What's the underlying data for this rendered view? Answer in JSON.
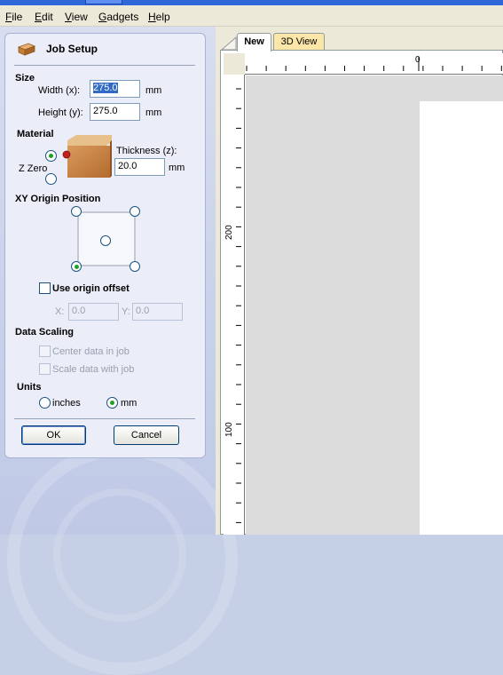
{
  "menu": [
    {
      "label": "File"
    },
    {
      "label": "Edit"
    },
    {
      "label": "View"
    },
    {
      "label": "Gadgets"
    },
    {
      "label": "Help"
    }
  ],
  "job_setup": {
    "title": "Job Setup",
    "size": {
      "heading": "Size",
      "width_label": "Width (x):",
      "width_value": "275.0",
      "width_unit": "mm",
      "height_label": "Height (y):",
      "height_value": "275.0",
      "height_unit": "mm"
    },
    "material": {
      "heading": "Material",
      "thickness_label": "Thickness (z):",
      "thickness_value": "20.0",
      "thickness_unit": "mm",
      "zzero_label": "Z Zero"
    },
    "xy_origin": {
      "heading": "XY Origin Position",
      "selected": "bottom-left"
    },
    "origin_offset": {
      "label": "Use origin offset",
      "checked": false,
      "x_label": "X:",
      "x_value": "0.0",
      "y_label": "Y:",
      "y_value": "0.0"
    },
    "data_scaling": {
      "heading": "Data Scaling",
      "center_label": "Center data in job",
      "scale_label": "Scale data with job"
    },
    "units": {
      "heading": "Units",
      "inches_label": "inches",
      "mm_label": "mm",
      "selected": "mm"
    },
    "ok_label": "OK",
    "cancel_label": "Cancel"
  },
  "tabs": [
    {
      "label": "New",
      "active": true
    },
    {
      "label": "3D View",
      "active": false
    }
  ],
  "rulers": {
    "h_zero_label": "0",
    "v_label_200": "200",
    "v_label_100": "100"
  },
  "colors": {
    "selection": "#316ac5",
    "radio_dot": "#21a121",
    "panel_bg": "#ebedf8",
    "inactive_tab": "#fce6a8"
  }
}
